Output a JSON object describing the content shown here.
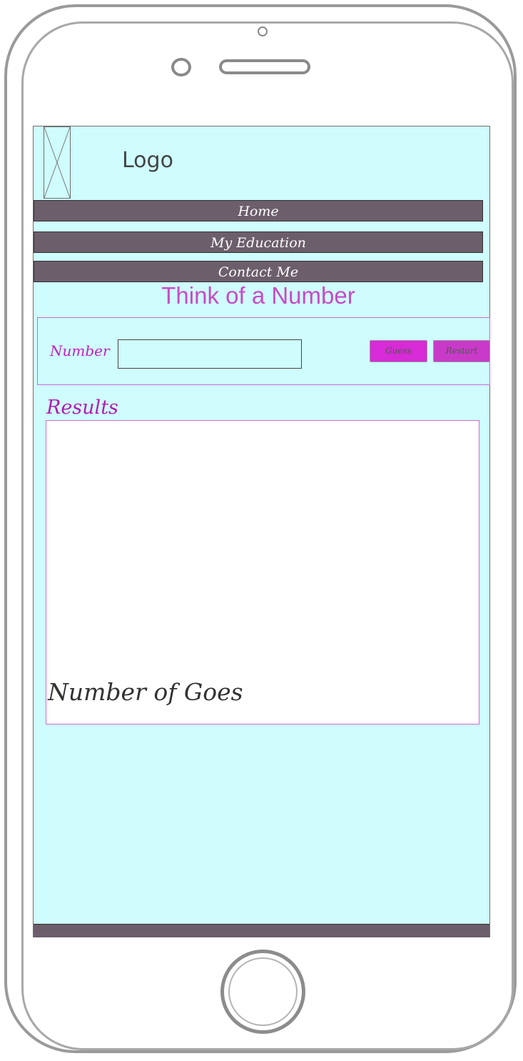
{
  "header": {
    "logo_text": "Logo"
  },
  "nav": {
    "home": "Home",
    "education": "My Education",
    "contact": "Contact Me"
  },
  "game": {
    "title": "Think of a Number",
    "number_label": "Number",
    "number_value": "",
    "guess_label": "Guess",
    "restart_label": "Restart"
  },
  "results": {
    "title": "Results",
    "goes_label": "Number of Goes"
  },
  "colors": {
    "screen_bg": "#cffcfd",
    "nav_bg": "#6c5e6b",
    "accent": "#c84bc6",
    "button": "#d62bd6"
  }
}
